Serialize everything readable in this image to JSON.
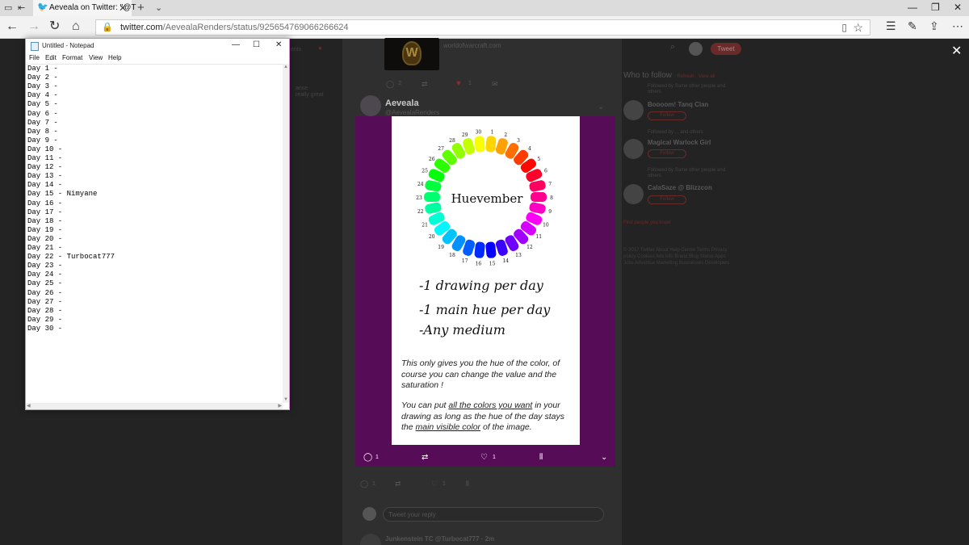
{
  "browser": {
    "tab_title": "Aeveala on Twitter: \"@T",
    "url_host": "twitter.com",
    "url_path": "/AevealaRenders/status/925654769066266624"
  },
  "twitter": {
    "site_preview": "worldofwarcraft.com",
    "reply_count_prev": "2",
    "like_count_prev": "1",
    "author_name": "Aeveala",
    "author_handle": "@AevealaRenders",
    "who_to_follow": "Who to follow",
    "who_to_follow_links": "· Refresh · View all",
    "suggestions": [
      {
        "meta": "Followed by Some other people and others",
        "name": "Boooom! Tanq Clan",
        "follow": "Follow"
      },
      {
        "meta": "Followed by ... and others",
        "name": "Magical Warlock Girl",
        "follow": "Follow"
      },
      {
        "meta": "Followed by Some other people and others",
        "name": "CalaSaze @ Blizzcon",
        "follow": "Follow"
      }
    ],
    "find_people": "Find people you know",
    "footer": "© 2017 Twitter  About  Help Center  Terms  Privacy policy  Cookies  Ads info  Brand  Blog  Status  Apps  Jobs  Advertise  Marketing  Businesses  Developers",
    "media_reply_count": "1",
    "media_like_count": "1",
    "below_reply_count": "1",
    "below_like_count": "1",
    "reply_placeholder": "Tweet your reply",
    "next_author": "Junkenstein  TC @Turbocat777 · 2m",
    "tweet_button": "Tweet",
    "left_faint": [
      "ents",
      "anse",
      "really great"
    ]
  },
  "image_card": {
    "center_title": "Huevember",
    "wheel_numbers": [
      "1",
      "2",
      "3",
      "4",
      "5",
      "6",
      "7",
      "8",
      "9",
      "10",
      "11",
      "12",
      "13",
      "14",
      "15",
      "16",
      "17",
      "18",
      "19",
      "20",
      "21",
      "22",
      "23",
      "24",
      "25",
      "26",
      "27",
      "28",
      "29",
      "30"
    ],
    "bullets": [
      "-1 drawing per day",
      "-1 main hue per day",
      "-Any medium"
    ],
    "para1": "This only gives you the hue of the color, of course you can change the value and the saturation !",
    "para2_a": "You can put ",
    "para2_u1": "all the colors you want",
    "para2_b": " in your drawing as long as the hue of the day stays the ",
    "para2_u2": "main visible color",
    "para2_c": " of the image."
  },
  "notepad": {
    "title": "Untitled - Notepad",
    "menu": [
      "File",
      "Edit",
      "Format",
      "View",
      "Help"
    ],
    "lines": [
      "Day 1 -",
      "Day 2 -",
      "Day 3 -",
      "Day 4 -",
      "Day 5 -",
      "Day 6 -",
      "Day 7 -",
      "Day 8 -",
      "Day 9 -",
      "Day 10 -",
      "Day 11 -",
      "Day 12 -",
      "Day 13 -",
      "Day 14 -",
      "Day 15 - Nimyane",
      "Day 16 -",
      "Day 17 -",
      "Day 18 -",
      "Day 19 -",
      "Day 20 -",
      "Day 21 -",
      "Day 22 - Turbocat777",
      "Day 23 -",
      "Day 24 -",
      "Day 25 -",
      "Day 26 -",
      "Day 27 -",
      "Day 28 -",
      "Day 29 -",
      "Day 30 -"
    ]
  },
  "colors": {
    "media_bg": "#570c57",
    "twitter_accent": "#6b2a2a",
    "notepad_border": "#d18ac8"
  }
}
